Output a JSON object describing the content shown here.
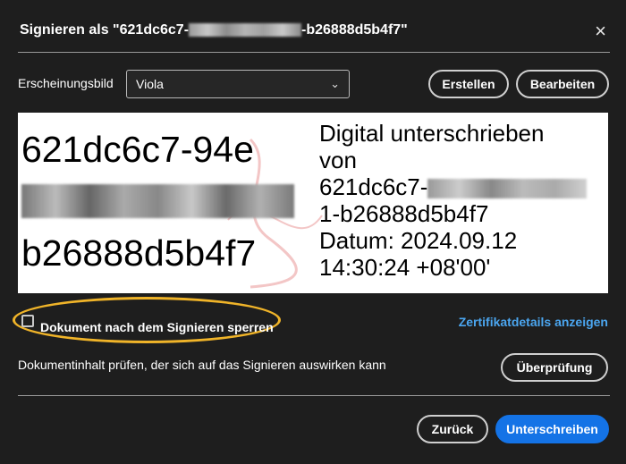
{
  "dialog": {
    "title_prefix": "Signieren als \"621dc6c7-",
    "title_suffix": "-b26888d5b4f7\"",
    "close_icon": "×"
  },
  "appearance": {
    "label": "Erscheinungsbild",
    "selected": "Viola",
    "chevron": "⌄",
    "create_label": "Erstellen",
    "edit_label": "Bearbeiten"
  },
  "preview": {
    "name_line1": "621dc6c7-94e",
    "name_line3": "b26888d5b4f7",
    "detail_line1": "Digital unterschrieben",
    "detail_line2": "von",
    "detail_line3": "621dc6c7-",
    "detail_line4": "1-b26888d5b4f7",
    "detail_line5": "Datum: 2024.09.12",
    "detail_line6": "14:30:24 +08'00'"
  },
  "options": {
    "lock_label": "Dokument nach dem Signieren sperren",
    "lock_checked": false,
    "cert_link": "Zertifikatdetails anzeigen",
    "review_text": "Dokumentinhalt prüfen, der sich auf das Signieren auswirken kann",
    "review_button": "Überprüfung"
  },
  "footer": {
    "back_label": "Zurück",
    "sign_label": "Unterschreiben"
  },
  "colors": {
    "background": "#1e1e1e",
    "primary": "#1473e6",
    "link": "#4ba6f0",
    "highlight": "#f0b429"
  }
}
